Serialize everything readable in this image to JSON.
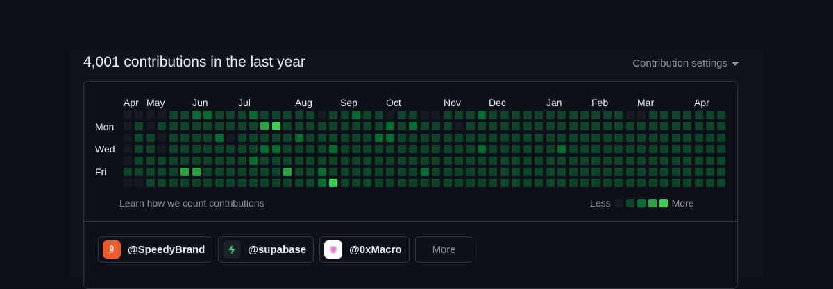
{
  "header": {
    "title": "4,001 contributions in the last year",
    "settings_label": "Contribution settings"
  },
  "calendar": {
    "months": [
      "Apr",
      "May",
      "Jun",
      "Jul",
      "Aug",
      "Sep",
      "Oct",
      "Nov",
      "Dec",
      "Jan",
      "Feb",
      "Mar",
      "Apr"
    ],
    "days": [
      "Mon",
      "Wed",
      "Fri"
    ],
    "colors": [
      "#161b22",
      "#0e4429",
      "#006d32",
      "#26a641",
      "#39d353"
    ],
    "levels": [
      [
        0,
        0,
        0,
        0,
        0,
        1,
        0
      ],
      [
        0,
        1,
        1,
        1,
        1,
        1,
        0
      ],
      [
        0,
        0,
        1,
        1,
        1,
        1,
        1
      ],
      [
        0,
        1,
        0,
        0,
        1,
        1,
        1
      ],
      [
        1,
        1,
        1,
        1,
        1,
        1,
        1
      ],
      [
        1,
        1,
        1,
        1,
        1,
        3,
        1
      ],
      [
        2,
        1,
        1,
        1,
        1,
        3,
        1
      ],
      [
        2,
        1,
        1,
        1,
        1,
        1,
        1
      ],
      [
        1,
        1,
        2,
        1,
        1,
        1,
        1
      ],
      [
        1,
        1,
        0,
        1,
        1,
        1,
        1
      ],
      [
        1,
        1,
        1,
        1,
        1,
        1,
        1
      ],
      [
        2,
        1,
        1,
        1,
        2,
        1,
        1
      ],
      [
        1,
        3,
        1,
        2,
        1,
        1,
        1
      ],
      [
        1,
        4,
        1,
        2,
        1,
        1,
        1
      ],
      [
        1,
        1,
        1,
        1,
        1,
        3,
        1
      ],
      [
        1,
        1,
        2,
        1,
        1,
        1,
        1
      ],
      [
        1,
        1,
        1,
        1,
        1,
        1,
        1
      ],
      [
        0,
        1,
        1,
        1,
        1,
        2,
        2
      ],
      [
        1,
        1,
        1,
        2,
        1,
        1,
        4
      ],
      [
        1,
        1,
        1,
        1,
        1,
        1,
        1
      ],
      [
        2,
        1,
        1,
        1,
        1,
        1,
        1
      ],
      [
        1,
        1,
        1,
        1,
        1,
        1,
        1
      ],
      [
        1,
        1,
        2,
        1,
        1,
        1,
        1
      ],
      [
        0,
        2,
        2,
        1,
        1,
        1,
        1
      ],
      [
        1,
        1,
        1,
        1,
        1,
        1,
        1
      ],
      [
        1,
        2,
        1,
        1,
        1,
        1,
        1
      ],
      [
        0,
        1,
        1,
        1,
        1,
        2,
        1
      ],
      [
        0,
        1,
        1,
        1,
        1,
        1,
        1
      ],
      [
        1,
        1,
        1,
        1,
        1,
        1,
        1
      ],
      [
        1,
        0,
        1,
        1,
        1,
        1,
        1
      ],
      [
        1,
        1,
        1,
        1,
        1,
        1,
        1
      ],
      [
        2,
        1,
        1,
        2,
        1,
        1,
        1
      ],
      [
        1,
        1,
        1,
        1,
        1,
        1,
        1
      ],
      [
        1,
        1,
        1,
        1,
        1,
        1,
        1
      ],
      [
        1,
        1,
        1,
        1,
        1,
        1,
        1
      ],
      [
        1,
        1,
        1,
        1,
        1,
        1,
        1
      ],
      [
        1,
        1,
        1,
        1,
        1,
        1,
        1
      ],
      [
        1,
        1,
        1,
        1,
        1,
        1,
        1
      ],
      [
        1,
        1,
        1,
        2,
        1,
        1,
        1
      ],
      [
        1,
        1,
        1,
        1,
        1,
        1,
        1
      ],
      [
        1,
        1,
        1,
        1,
        1,
        1,
        1
      ],
      [
        1,
        1,
        1,
        1,
        1,
        1,
        1
      ],
      [
        1,
        1,
        1,
        1,
        1,
        1,
        1
      ],
      [
        1,
        1,
        1,
        1,
        1,
        1,
        1
      ],
      [
        0,
        1,
        1,
        1,
        1,
        1,
        1
      ],
      [
        0,
        1,
        1,
        1,
        1,
        1,
        1
      ],
      [
        1,
        1,
        1,
        1,
        1,
        1,
        1
      ],
      [
        1,
        1,
        1,
        1,
        1,
        1,
        1
      ],
      [
        1,
        1,
        1,
        1,
        1,
        1,
        1
      ],
      [
        1,
        1,
        1,
        1,
        1,
        1,
        1
      ],
      [
        1,
        1,
        1,
        1,
        1,
        1,
        1
      ],
      [
        1,
        1,
        1,
        1,
        1,
        1,
        1
      ],
      [
        1,
        1,
        1,
        1,
        1,
        1,
        1
      ]
    ]
  },
  "learn_link": "Learn how we count contributions",
  "legend": {
    "less": "Less",
    "more": "More",
    "levels": [
      0,
      1,
      2,
      3,
      4
    ]
  },
  "organizations": [
    {
      "label": "@SpeedyBrand",
      "icon": "rocket-icon",
      "color": "#f05a28"
    },
    {
      "label": "@supabase",
      "icon": "lightning-bolt-icon",
      "color": "#3ecf8e"
    },
    {
      "label": "@0xMacro",
      "icon": "macro-logo-icon",
      "color": "#e879c9"
    }
  ],
  "more_button": "More"
}
